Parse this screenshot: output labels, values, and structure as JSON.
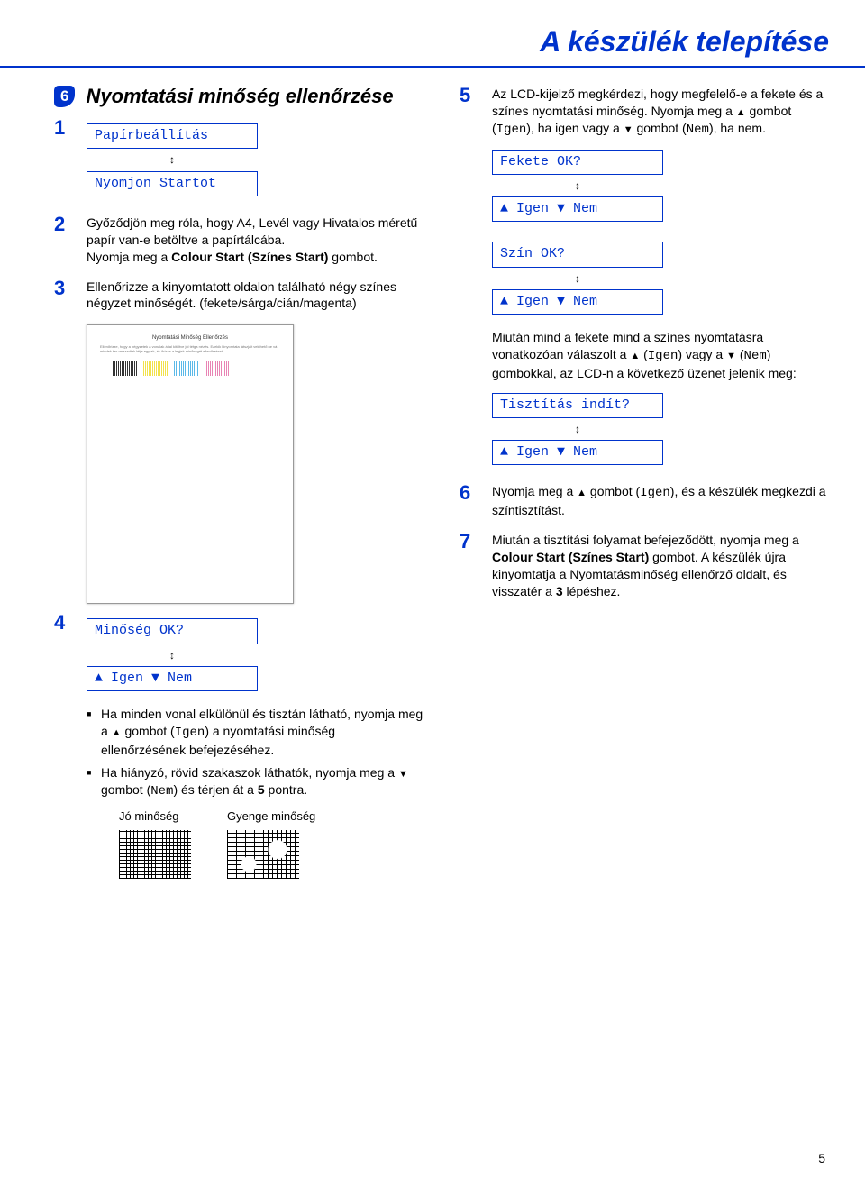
{
  "page_title": "A készülék telepítése",
  "page_number": "5",
  "section": {
    "badge": "6",
    "heading": "Nyomtatási minőség ellenőrzése"
  },
  "left": {
    "s1": {
      "num": "1",
      "lcd1": "Papírbeállítás",
      "lcd2": "Nyomjon Startot"
    },
    "s2": {
      "num": "2",
      "p1a": "Győződjön meg róla, hogy A4, Levél vagy Hivatalos méretű papír van-e betöltve a papírtálcába.",
      "p1b_pre": "Nyomja meg a ",
      "p1b_bold": "Colour Start (Színes Start)",
      "p1b_post": " gombot."
    },
    "s3": {
      "num": "3",
      "text": "Ellenőrizze a kinyomtatott oldalon található négy színes négyzet minőségét. (fekete/sárga/cián/magenta)",
      "preview_title": "Nyomtatási Minőség Ellenőrzés",
      "preview_text": "Ellenőrizze, hogy a négyzetek a vonalak által kitöltve jól tétga nézés. Ezekik kinyomtata látszjait vekthető ne vá mindek tes rmezadtak létja egytak, és őrizze a legjek minőségét ellenőrzéset."
    },
    "s4": {
      "num": "4",
      "lcd": "Minőség OK?",
      "opt": "▲ Igen ▼ Nem",
      "b1_a": "Ha minden vonal elkülönül és tisztán látható, nyomja meg a ",
      "b1_b": " gombot (",
      "b1_code": "Igen",
      "b1_c": ") a nyomtatási minőség ellenőrzésének befejezéséhez.",
      "b2_a": "Ha hiányzó, rövid szakaszok láthatók, nyomja meg a ",
      "b2_b": " gombot (",
      "b2_code": "Nem",
      "b2_c": ") és térjen át a ",
      "b2_bold": "5",
      "b2_d": " pontra.",
      "q_good": "Jó minőség",
      "q_bad": "Gyenge minőség"
    }
  },
  "right": {
    "s5": {
      "num": "5",
      "p1_a": "Az LCD-kijelző megkérdezi, hogy megfelelő-e a fekete és a színes nyomtatási minőség. Nyomja meg a ",
      "p1_b": " gombot (",
      "p1_code1": "Igen",
      "p1_c": "), ha igen vagy a ",
      "p1_d": " gombot (",
      "p1_code2": "Nem",
      "p1_e": "), ha nem.",
      "lcd1": "Fekete OK?",
      "opt1": "▲ Igen ▼ Nem",
      "lcd2": "Szín OK?",
      "opt2": "▲ Igen ▼ Nem",
      "p2_a": "Miután mind a fekete mind a színes nyomtatásra vonatkozóan válaszolt a ",
      "p2_b": " (",
      "p2_code1": "Igen",
      "p2_c": ") vagy a ",
      "p2_d": " (",
      "p2_code2": "Nem",
      "p2_e": ") gombokkal, az LCD-n a következő üzenet jelenik meg:",
      "lcd3": "Tisztítás indít?",
      "opt3": "▲ Igen ▼ Nem"
    },
    "s6": {
      "num": "6",
      "a": "Nyomja meg a ",
      "b": " gombot (",
      "code": "Igen",
      "c": "), és a készülék megkezdi a színtisztítást."
    },
    "s7": {
      "num": "7",
      "a": "Miután a tisztítási folyamat befejeződött, nyomja meg a ",
      "bold1": "Colour Start (Színes Start)",
      "b": " gombot. A készülék újra kinyomtatja a Nyomtatásminőség ellenőrző oldalt, és visszatér a ",
      "bold2": "3",
      "c": " lépéshez."
    }
  }
}
